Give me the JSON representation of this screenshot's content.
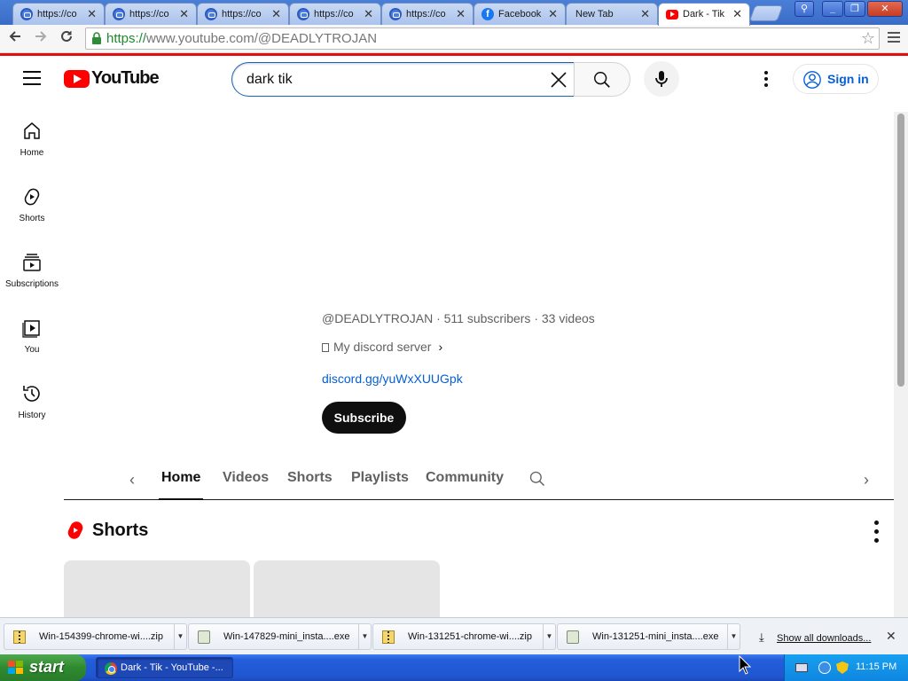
{
  "browser": {
    "tabs": [
      {
        "title": "https://co",
        "icon": "generic-page-icon"
      },
      {
        "title": "https://co",
        "icon": "generic-page-icon"
      },
      {
        "title": "https://co",
        "icon": "generic-page-icon"
      },
      {
        "title": "https://co",
        "icon": "generic-page-icon"
      },
      {
        "title": "https://co",
        "icon": "generic-page-icon"
      },
      {
        "title": "Facebook",
        "icon": "facebook-icon"
      },
      {
        "title": "New Tab",
        "icon": ""
      },
      {
        "title": "Dark - Tik",
        "icon": "youtube-icon"
      }
    ],
    "url_scheme": "https://",
    "url_rest": "www.youtube.com/@DEADLYTROJAN",
    "accent_color": "#e01010"
  },
  "youtube": {
    "logo_text": "YouTube",
    "search_value": "dark tik",
    "signin_label": "Sign in",
    "sidebar": [
      {
        "label": "Home",
        "icon": "home-icon"
      },
      {
        "label": "Shorts",
        "icon": "shorts-icon"
      },
      {
        "label": "Subscriptions",
        "icon": "subscriptions-icon"
      },
      {
        "label": "You",
        "icon": "you-icon"
      },
      {
        "label": "History",
        "icon": "history-icon"
      }
    ],
    "channel": {
      "meta": "@DEADLYTROJAN · 511 subscribers · 33 videos",
      "link_title": "My discord server",
      "link_url": "discord.gg/yuWxXUUGpk",
      "subscribe_label": "Subscribe"
    },
    "tabs": [
      "Home",
      "Videos",
      "Shorts",
      "Playlists",
      "Community"
    ],
    "active_tab": "Home",
    "shorts_heading": "Shorts"
  },
  "downloads": {
    "items": [
      {
        "name": "Win-154399-chrome-wi....zip",
        "type": "zip"
      },
      {
        "name": "Win-147829-mini_insta....exe",
        "type": "exe"
      },
      {
        "name": "Win-131251-chrome-wi....zip",
        "type": "zip"
      },
      {
        "name": "Win-131251-mini_insta....exe",
        "type": "exe"
      }
    ],
    "show_all": "Show all downloads..."
  },
  "taskbar": {
    "start_label": "start",
    "task_title": "Dark - Tik - YouTube -...",
    "clock": "11:15 PM"
  }
}
